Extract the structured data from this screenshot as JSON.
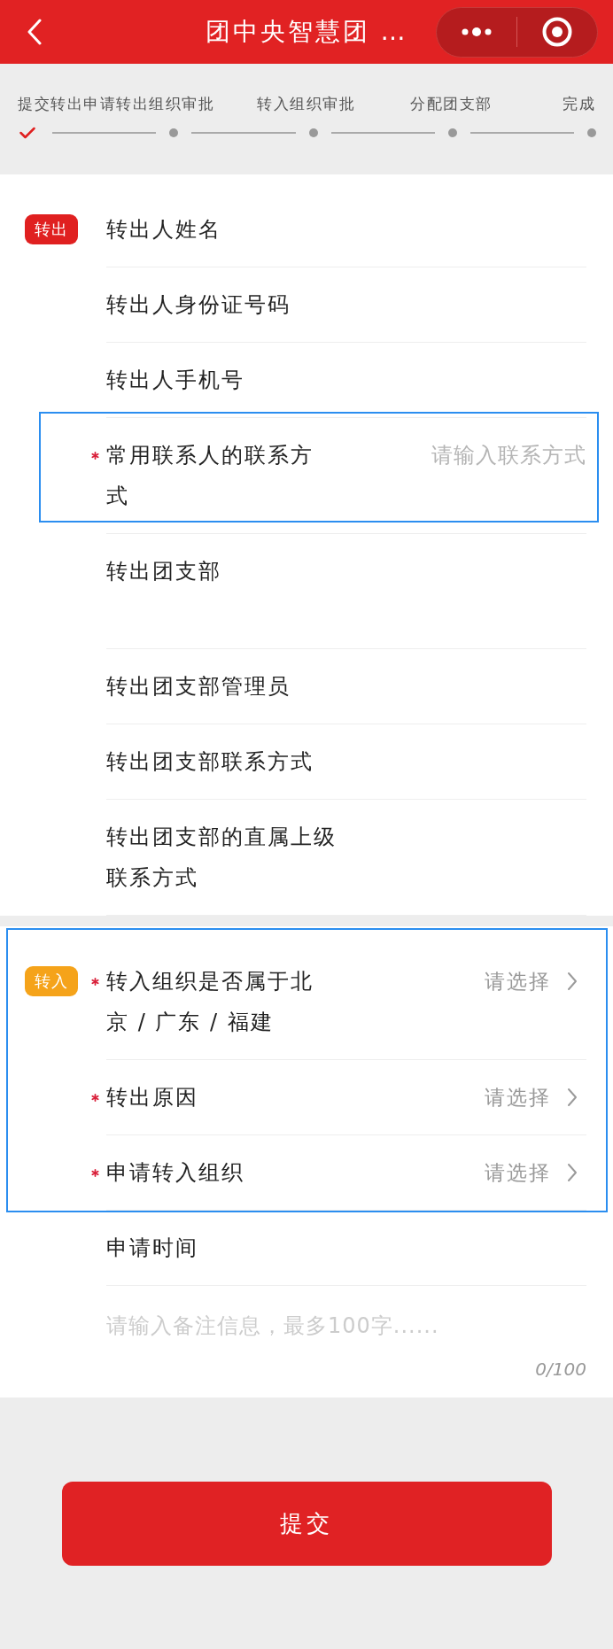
{
  "header": {
    "title": "团中央智慧团 …"
  },
  "steps": [
    {
      "label": "提交转出申请",
      "done": true
    },
    {
      "label": "转出组织审批",
      "done": false
    },
    {
      "label": "转入组织审批",
      "done": false
    },
    {
      "label": "分配团支部",
      "done": false
    },
    {
      "label": "完成",
      "done": false
    }
  ],
  "sections": [
    {
      "badge": {
        "text": "转出",
        "color": "#e02020"
      },
      "rows": [
        {
          "kind": "plain",
          "label": "转出人姓名",
          "required": false,
          "highlighted": false
        },
        {
          "kind": "plain",
          "label": "转出人身份证号码",
          "required": false,
          "highlighted": false
        },
        {
          "kind": "plain",
          "label": "转出人手机号",
          "required": false,
          "highlighted": false
        },
        {
          "kind": "input",
          "label": "常用联系人的联系方式",
          "required": true,
          "highlighted": true,
          "placeholder": "请输入联系方式"
        },
        {
          "kind": "tall",
          "label": "转出团支部",
          "required": false,
          "highlighted": false
        },
        {
          "kind": "plain",
          "label": "转出团支部管理员",
          "required": false,
          "highlighted": false
        },
        {
          "kind": "plain",
          "label": "转出团支部联系方式",
          "required": false,
          "highlighted": false
        },
        {
          "kind": "plain",
          "label": "转出团支部的直属上级联系方式",
          "required": false,
          "highlighted": false
        }
      ]
    },
    {
      "badge": {
        "text": "转入",
        "color": "#f5a31a"
      },
      "rows": [
        {
          "kind": "select",
          "label": "转入组织是否属于北京 / 广东 / 福建",
          "required": true,
          "highlighted": true,
          "placeholder": "请选择"
        },
        {
          "kind": "select",
          "label": "转出原因",
          "required": true,
          "highlighted": true,
          "placeholder": "请选择"
        },
        {
          "kind": "select",
          "label": "申请转入组织",
          "required": true,
          "highlighted": true,
          "placeholder": "请选择"
        },
        {
          "kind": "plain",
          "label": "申请时间",
          "required": false,
          "highlighted": false
        }
      ],
      "remarks": {
        "placeholder": "请输入备注信息，最多100字......",
        "counter": "0/100"
      }
    }
  ],
  "submit": {
    "label": "提交"
  }
}
